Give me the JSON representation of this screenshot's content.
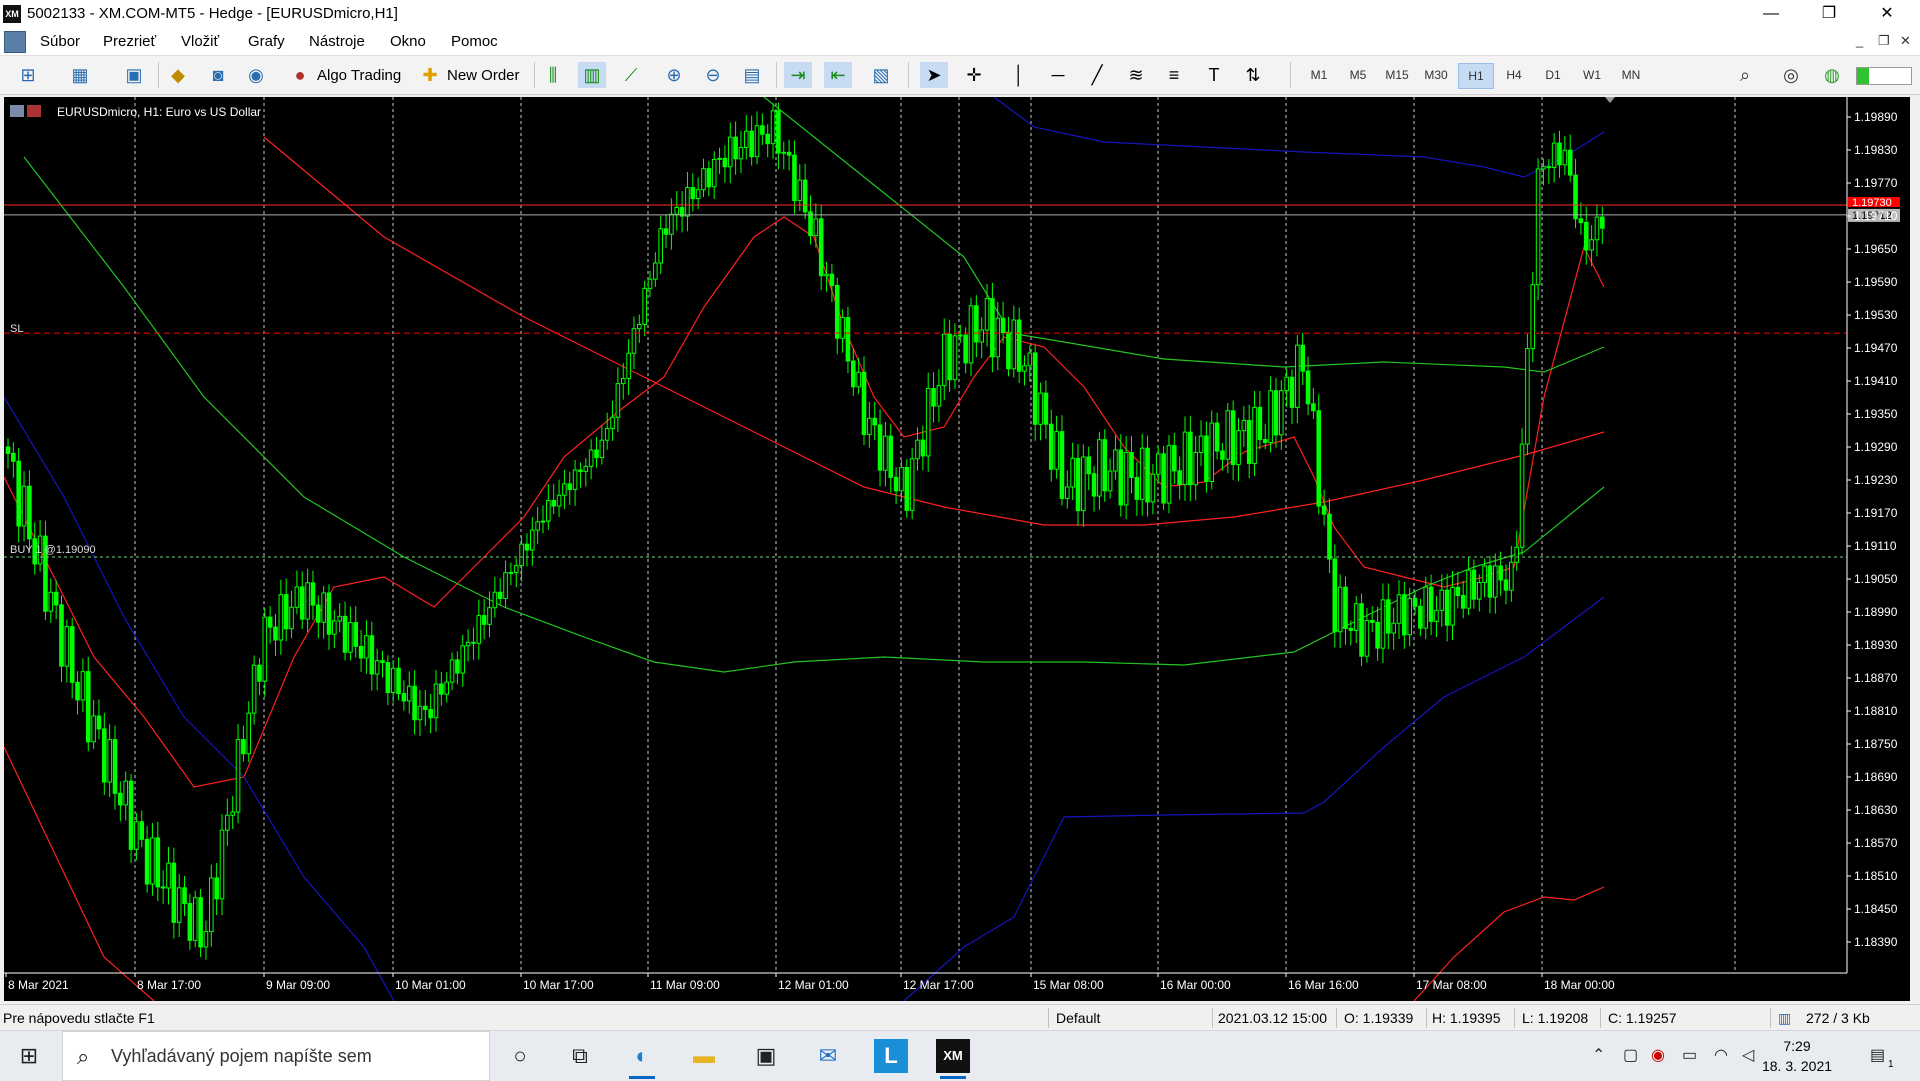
{
  "window": {
    "logo": "XM",
    "title": "5002133 - XM.COM-MT5 - Hedge - [EURUSDmicro,H1]",
    "minimize": "—",
    "restore": "❐",
    "close": "✕"
  },
  "menu": {
    "items": [
      "Súbor",
      "Prezrieť",
      "Vložiť",
      "Grafy",
      "Nástroje",
      "Okno",
      "Pomoc"
    ],
    "mdi_minimize": "_",
    "mdi_restore": "❐",
    "mdi_close": "✕"
  },
  "toolbar": {
    "algo_trading": "Algo Trading",
    "new_order": "New Order",
    "timeframes": [
      "M1",
      "M5",
      "M15",
      "M30",
      "H1",
      "H4",
      "D1",
      "W1",
      "MN"
    ],
    "active_timeframe": "H1"
  },
  "chart": {
    "symbol_label": "EURUSDmicro, H1:  Euro vs US Dollar",
    "sl_label": "SL",
    "buy_label": "BUY 1  @1.19090",
    "ask_price": "1.19730",
    "bid_price": "1.19712",
    "price_ticks": [
      "1.19890",
      "1.19830",
      "1.19770",
      "1.19710",
      "1.19650",
      "1.19590",
      "1.19530",
      "1.19470",
      "1.19410",
      "1.19350",
      "1.19290",
      "1.19230",
      "1.19170",
      "1.19110",
      "1.19050",
      "1.18990",
      "1.18930",
      "1.18870",
      "1.18810",
      "1.18750",
      "1.18690",
      "1.18630",
      "1.18570",
      "1.18510",
      "1.18450",
      "1.18390"
    ],
    "time_ticks": [
      "8 Mar 2021",
      "8 Mar 17:00",
      "9 Mar 09:00",
      "10 Mar 01:00",
      "10 Mar 17:00",
      "11 Mar 09:00",
      "12 Mar 01:00",
      "12 Mar 17:00",
      "15 Mar 08:00",
      "16 Mar 00:00",
      "16 Mar 16:00",
      "17 Mar 08:00",
      "18 Mar 00:00"
    ],
    "colors": {
      "background": "#000000",
      "candle": "#00ff00",
      "grid": "#c8c8c8",
      "ma_red": "#ff2020",
      "ma_green": "#22c422",
      "ma_blue": "#1515c0",
      "sl_line": "#ff0000",
      "buy_line": "#7fcf7f"
    }
  },
  "status": {
    "help": "Pre nápovedu stlačte F1",
    "profile": "Default",
    "datetime": "2021.03.12 15:00",
    "open": "O: 1.19339",
    "high": "H: 1.19395",
    "low": "L: 1.19208",
    "close": "C: 1.19257",
    "traffic": "272 / 3 Kb"
  },
  "taskbar": {
    "search_placeholder": "Vyhľadávaný pojem napíšte sem",
    "time": "7:29",
    "date": "18. 3. 2021",
    "notification_count": "1",
    "apps": [
      "cortana",
      "task-view",
      "edge",
      "file-explorer",
      "store",
      "mail",
      "l-app",
      "xm-mt5"
    ]
  }
}
